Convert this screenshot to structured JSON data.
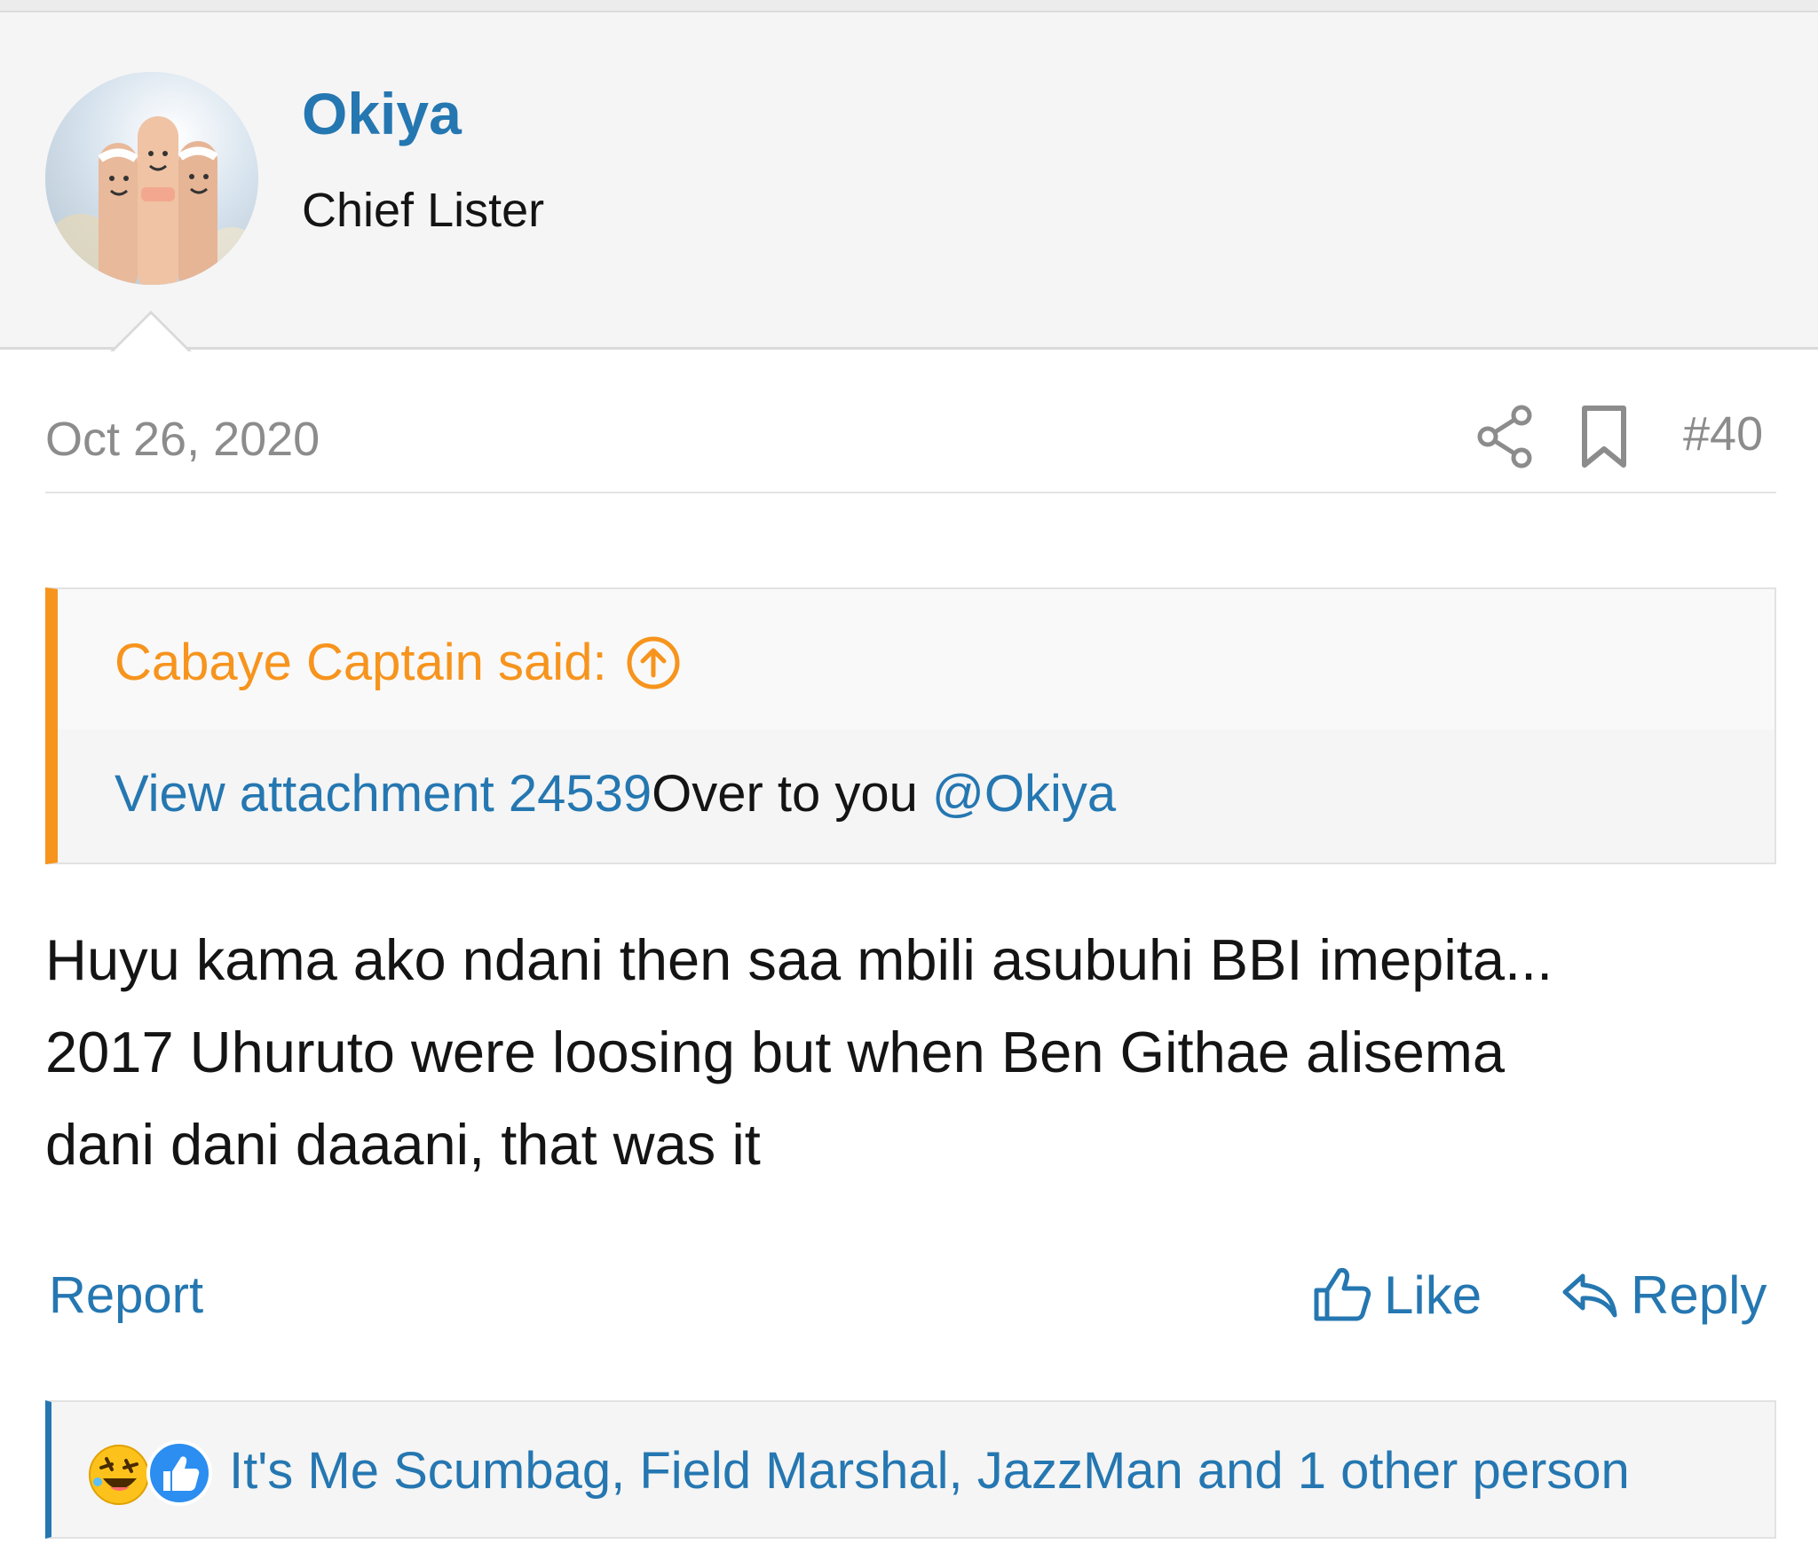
{
  "author": {
    "username": "Okiya",
    "title": "Chief Lister",
    "avatar_icon": "finger-faces-avatar"
  },
  "post": {
    "date": "Oct 26, 2020",
    "number": "#40",
    "share_icon": "share-icon",
    "bookmark_icon": "bookmark-icon"
  },
  "quote": {
    "attribution": "Cabaye Captain said:",
    "attachment_link": "View attachment 24539",
    "text": "Over to you ",
    "mention": "@Okiya"
  },
  "message": {
    "line1": "Huyu kama ako ndani then saa mbili asubuhi BBI imepita...",
    "line2": "2017 Uhuruto were loosing but when Ben Githae alisema",
    "line3": "dani dani daaani, that was it"
  },
  "actions": {
    "report": "Report",
    "like": "Like",
    "reply": "Reply"
  },
  "reactions": {
    "summary": "It's Me Scumbag, Field Marshal, JazzMan and 1 other person",
    "icons": [
      "haha-reaction-icon",
      "like-reaction-icon"
    ]
  },
  "colors": {
    "link": "#2577b1",
    "quote_accent": "#f7941d",
    "muted": "#8c8c8c",
    "text": "#141414"
  }
}
